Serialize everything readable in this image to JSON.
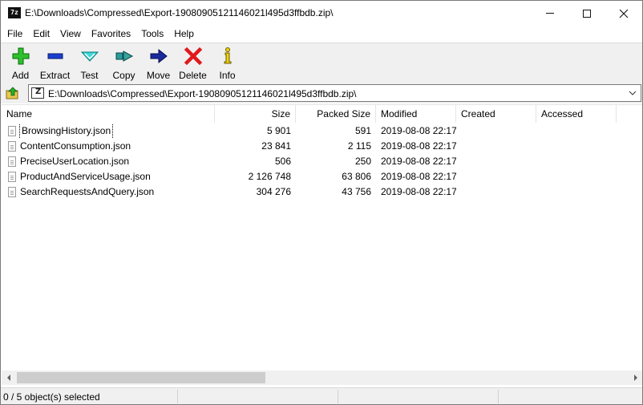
{
  "window": {
    "app_icon_text": "7z",
    "title": "E:\\Downloads\\Compressed\\Export-19080905121146021l495d3ffbdb.zip\\"
  },
  "menu": [
    "File",
    "Edit",
    "View",
    "Favorites",
    "Tools",
    "Help"
  ],
  "toolbar": [
    {
      "label": "Add",
      "icon": "add-icon",
      "color": "#22b322"
    },
    {
      "label": "Extract",
      "icon": "extract-icon",
      "color": "#1a3fd1"
    },
    {
      "label": "Test",
      "icon": "test-icon",
      "color": "#20c8c8"
    },
    {
      "label": "Copy",
      "icon": "copy-icon",
      "color": "#2a8a8a"
    },
    {
      "label": "Move",
      "icon": "move-icon",
      "color": "#1a2a9c"
    },
    {
      "label": "Delete",
      "icon": "delete-icon",
      "color": "#e01a1a"
    },
    {
      "label": "Info",
      "icon": "info-icon",
      "color": "#e0c010"
    }
  ],
  "address": {
    "path": "E:\\Downloads\\Compressed\\Export-19080905121146021l495d3ffbdb.zip\\"
  },
  "columns": [
    {
      "label": "Name"
    },
    {
      "label": "Size"
    },
    {
      "label": "Packed Size"
    },
    {
      "label": "Modified"
    },
    {
      "label": "Created"
    },
    {
      "label": "Accessed"
    }
  ],
  "files": [
    {
      "name": "BrowsingHistory.json",
      "size": "5 901",
      "packed": "591",
      "modified": "2019-08-08 22:17",
      "created": "",
      "accessed": ""
    },
    {
      "name": "ContentConsumption.json",
      "size": "23 841",
      "packed": "2 115",
      "modified": "2019-08-08 22:17",
      "created": "",
      "accessed": ""
    },
    {
      "name": "PreciseUserLocation.json",
      "size": "506",
      "packed": "250",
      "modified": "2019-08-08 22:17",
      "created": "",
      "accessed": ""
    },
    {
      "name": "ProductAndServiceUsage.json",
      "size": "2 126 748",
      "packed": "63 806",
      "modified": "2019-08-08 22:17",
      "created": "",
      "accessed": ""
    },
    {
      "name": "SearchRequestsAndQuery.json",
      "size": "304 276",
      "packed": "43 756",
      "modified": "2019-08-08 22:17",
      "created": "",
      "accessed": ""
    }
  ],
  "status": {
    "selection": "0 / 5 object(s) selected"
  }
}
